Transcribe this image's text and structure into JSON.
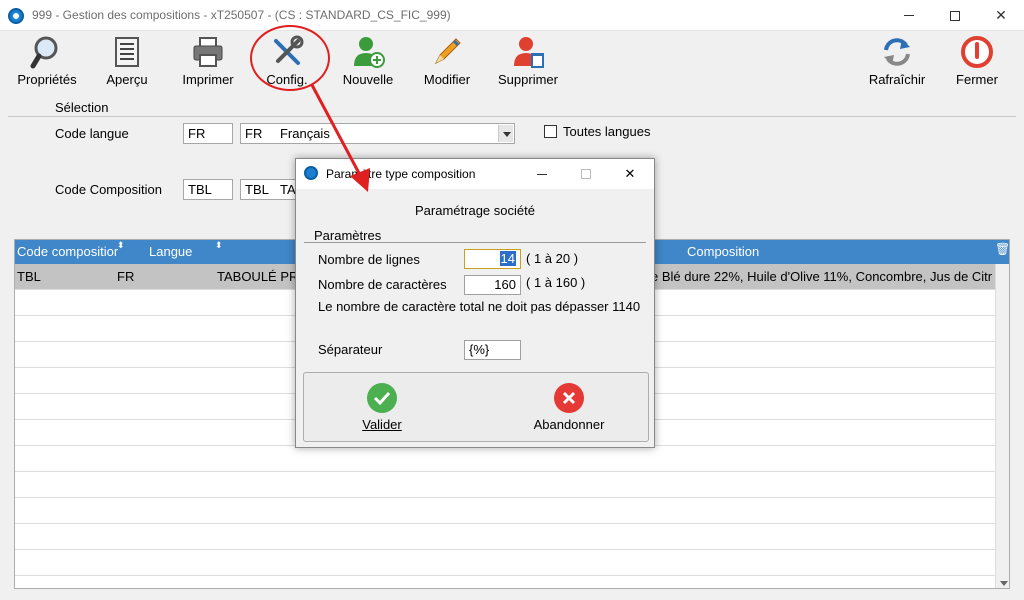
{
  "window": {
    "title": "999 - Gestion des compositions - xT250507 - (CS : STANDARD_CS_FIC_999)"
  },
  "toolbar": {
    "buttons": [
      {
        "label": "Propriétés",
        "icon": "magnifier-icon"
      },
      {
        "label": "Aperçu",
        "icon": "document-preview-icon"
      },
      {
        "label": "Imprimer",
        "icon": "printer-icon"
      },
      {
        "label": "Config.",
        "icon": "wrench-screwdriver-icon"
      },
      {
        "label": "Nouvelle",
        "icon": "user-add-icon"
      },
      {
        "label": "Modifier",
        "icon": "pencil-icon"
      },
      {
        "label": "Supprimer",
        "icon": "user-delete-icon"
      },
      {
        "label": "Rafraîchir",
        "icon": "refresh-icon"
      },
      {
        "label": "Fermer",
        "icon": "power-icon"
      }
    ]
  },
  "selection": {
    "title": "Sélection",
    "code_langue_label": "Code langue",
    "code_langue_value": "FR",
    "langue_combo_code": "FR",
    "langue_combo_name": "Français",
    "toutes_langues_label": "Toutes langues",
    "code_composition_label": "Code Composition",
    "code_composition_value": "TBL",
    "composition_combo_code": "TBL",
    "composition_combo_name": "TA"
  },
  "grid": {
    "headers": [
      "Code compositior",
      "Langue",
      "",
      "Composition"
    ],
    "rows": [
      {
        "code": "TBL",
        "langue": "FR",
        "libelle": "TABOULÉ PR",
        "composition": "e Blé dure 22%, Huile d'Olive 11%, Concombre, Jus de Citr"
      }
    ]
  },
  "dialog": {
    "title": "Paramètre type composition",
    "subtitle": "Paramétrage société",
    "group": "Paramètres",
    "nb_lignes_label": "Nombre de lignes",
    "nb_lignes_value": "14",
    "nb_lignes_range": "( 1 à 20 )",
    "nb_car_label": "Nombre de caractères",
    "nb_car_value": "160",
    "nb_car_range": "( 1 à 160 )",
    "note": "Le nombre de caractère total ne doit pas dépasser 1140",
    "separateur_label": "Séparateur",
    "separateur_value": "{%}",
    "valider_label": "Valider",
    "abandonner_label": "Abandonner"
  },
  "colors": {
    "accent": "#3f87c8",
    "highlight": "#e02020",
    "valid": "#4caf50",
    "cancel": "#e53935"
  }
}
